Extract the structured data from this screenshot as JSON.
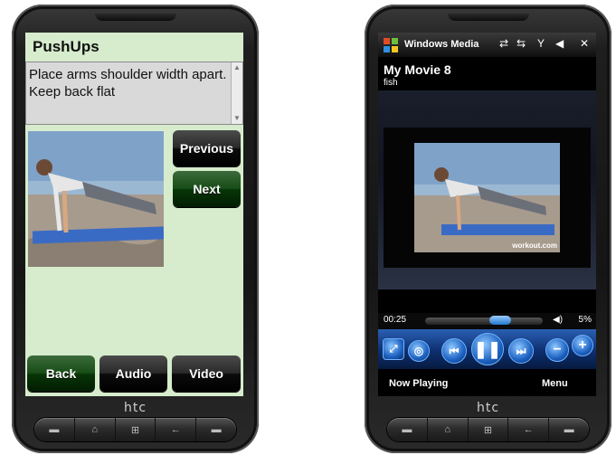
{
  "left_app": {
    "title": "PushUps",
    "instructions": "Place arms shoulder width apart. Keep back flat",
    "buttons": {
      "previous": "Previous",
      "next": "Next",
      "back": "Back",
      "audio": "Audio",
      "video": "Video"
    }
  },
  "right_app": {
    "app_name": "Windows Media",
    "close": "✕",
    "movie_title": "My Movie 8",
    "movie_subtitle": "fish",
    "watermark": "workout.com",
    "time": "00:25",
    "volume": "5%",
    "softkeys": {
      "left": "Now Playing",
      "right": "Menu"
    }
  },
  "device": {
    "brand": "htc"
  }
}
